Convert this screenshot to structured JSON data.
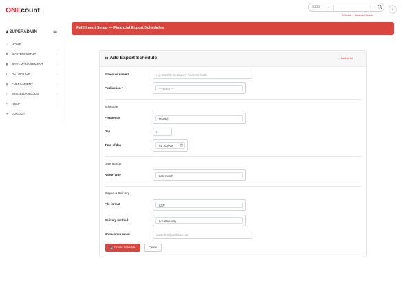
{
  "header": {
    "logo_prefix": "ONE",
    "logo_suffix": "count",
    "search_scope": "GOOD",
    "search_shortcut": "/",
    "links": [
      "All Users",
      "Advanced Search"
    ]
  },
  "sidebar": {
    "user": "SUPERADMIN",
    "items": [
      {
        "label": "HOME",
        "icon": "home-icon",
        "has_children": false
      },
      {
        "label": "SYSTEM SETUP",
        "icon": "gear-icon",
        "has_children": true
      },
      {
        "label": "DATA MANAGEMENT",
        "icon": "database-icon",
        "has_children": true
      },
      {
        "label": "ACTIVATION",
        "icon": "toggle-icon",
        "has_children": true
      },
      {
        "label": "FULFILLMENT",
        "icon": "inbox-icon",
        "has_children": true
      },
      {
        "label": "MISCELLANEOUS",
        "icon": "file-icon",
        "has_children": true
      },
      {
        "label": "HELP",
        "icon": "question-icon",
        "has_children": true
      },
      {
        "label": "LOGOUT",
        "icon": "logout-icon",
        "has_children": false
      }
    ]
  },
  "page": {
    "title": "Fulfillment Setup — Financial Export Schedules"
  },
  "form": {
    "title": "Add Export Schedule",
    "back_link": "← Back to list",
    "schedule_name_label": "Schedule name *",
    "schedule_name_placeholder": "e.g. Monthly GL Export - Anders's Cable",
    "publication_label": "Publication *",
    "publication_value": "— select —",
    "schedule_section": "Schedule",
    "frequency_label": "Frequency",
    "frequency_value": "Monthly",
    "day_label": "Day",
    "day_value": "1",
    "time_label": "Time of day",
    "time_value": "02 : 00 AM",
    "date_range_section": "Date Range",
    "range_type_label": "Range type",
    "range_type_value": "Last month",
    "output_section": "Output & Delivery",
    "file_format_label": "File format",
    "file_format_value": "CSV",
    "delivery_label": "Delivery method",
    "delivery_value": "Local file only",
    "email_label": "Notification email",
    "email_placeholder": "controller@publisher.com",
    "create_button": "Create Schedule",
    "cancel_button": "Cancel"
  },
  "colors": {
    "brand": "#e21b2a",
    "titlebar": "#d9463e"
  }
}
